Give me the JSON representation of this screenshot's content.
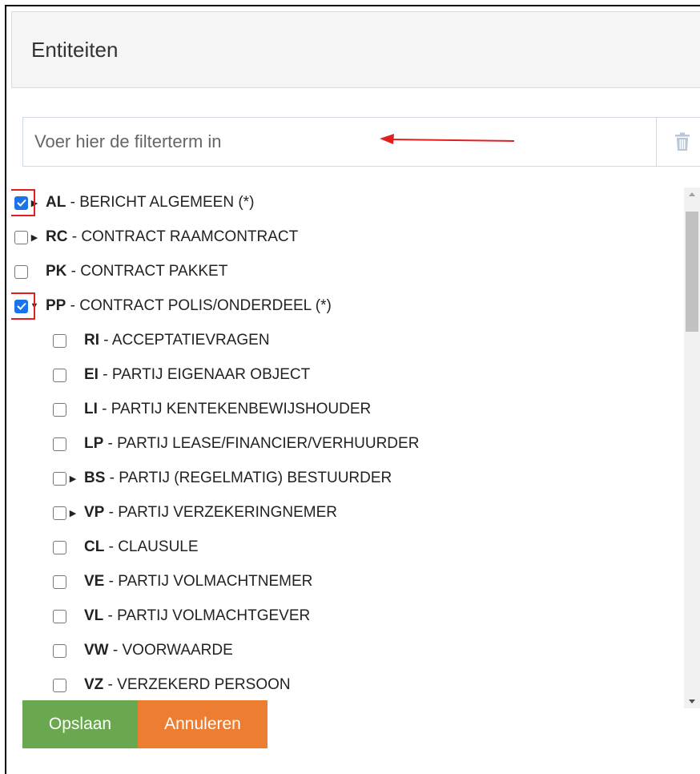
{
  "header": {
    "title": "Entiteiten"
  },
  "filter": {
    "placeholder": "Voer hier de filterterm in",
    "clear_icon": "trash-icon"
  },
  "tree": [
    {
      "code": "AL",
      "label": " - BERICHT ALGEMEEN (*)",
      "checked": true,
      "expander": "collapsed",
      "level": 0,
      "highlighted": true
    },
    {
      "code": "RC",
      "label": " - CONTRACT RAAMCONTRACT",
      "checked": false,
      "expander": "collapsed",
      "level": 0
    },
    {
      "code": "PK",
      "label": " - CONTRACT PAKKET",
      "checked": false,
      "expander": "none",
      "level": 0
    },
    {
      "code": "PP",
      "label": " - CONTRACT POLIS/ONDERDEEL (*)",
      "checked": true,
      "expander": "expanded",
      "level": 0,
      "highlighted": true
    },
    {
      "code": "RI",
      "label": " - ACCEPTATIEVRAGEN",
      "checked": false,
      "expander": "none",
      "level": 1
    },
    {
      "code": "EI",
      "label": " - PARTIJ EIGENAAR OBJECT",
      "checked": false,
      "expander": "none",
      "level": 1
    },
    {
      "code": "LI",
      "label": " - PARTIJ KENTEKENBEWIJSHOUDER",
      "checked": false,
      "expander": "none",
      "level": 1
    },
    {
      "code": "LP",
      "label": " - PARTIJ LEASE/FINANCIER/VERHUURDER",
      "checked": false,
      "expander": "none",
      "level": 1
    },
    {
      "code": "BS",
      "label": " - PARTIJ (REGELMATIG) BESTUURDER",
      "checked": false,
      "expander": "collapsed",
      "level": 1
    },
    {
      "code": "VP",
      "label": " - PARTIJ VERZEKERINGNEMER",
      "checked": false,
      "expander": "collapsed",
      "level": 1
    },
    {
      "code": "CL",
      "label": " - CLAUSULE",
      "checked": false,
      "expander": "none",
      "level": 1
    },
    {
      "code": "VE",
      "label": " - PARTIJ VOLMACHTNEMER",
      "checked": false,
      "expander": "none",
      "level": 1
    },
    {
      "code": "VL",
      "label": " - PARTIJ VOLMACHTGEVER",
      "checked": false,
      "expander": "none",
      "level": 1
    },
    {
      "code": "VW",
      "label": " - VOORWAARDE",
      "checked": false,
      "expander": "none",
      "level": 1
    },
    {
      "code": "VZ",
      "label": " - VERZEKERD PERSOON",
      "checked": false,
      "expander": "none",
      "level": 1
    }
  ],
  "buttons": {
    "save": "Opslaan",
    "cancel": "Annuleren"
  },
  "colors": {
    "save": "#6aa84f",
    "cancel": "#ed7d31",
    "checkbox": "#1a73e8",
    "highlight": "#e02020",
    "arrow": "#e02020"
  }
}
